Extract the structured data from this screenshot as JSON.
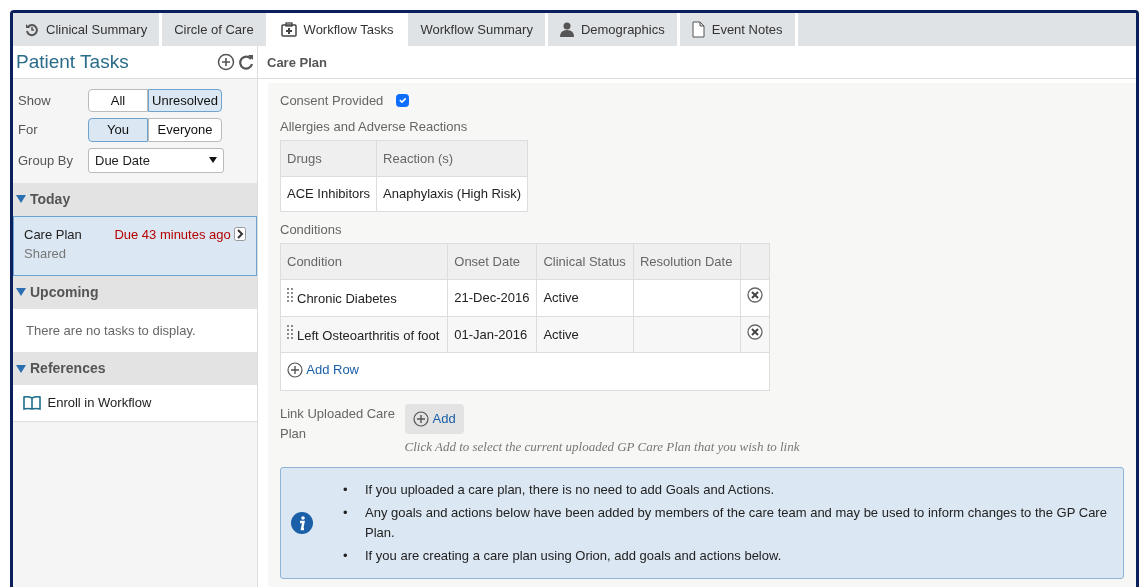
{
  "tabs": [
    {
      "label": "Clinical Summary",
      "selected": false
    },
    {
      "label": "Circle of Care",
      "selected": false
    },
    {
      "label": "Workflow Tasks",
      "selected": true
    },
    {
      "label": "Workflow Summary",
      "selected": false
    },
    {
      "label": "Demographics",
      "selected": false
    },
    {
      "label": "Event Notes",
      "selected": false
    }
  ],
  "sidebar": {
    "title": "Patient Tasks",
    "filters": [
      {
        "label": "Show",
        "kind": "toggle",
        "options": [
          {
            "label": "All",
            "selected": false
          },
          {
            "label": "Unresolved",
            "selected": true
          }
        ]
      },
      {
        "label": "For",
        "kind": "toggle",
        "options": [
          {
            "label": "You",
            "selected": true
          },
          {
            "label": "Everyone",
            "selected": false
          }
        ]
      },
      {
        "label": "Group By",
        "kind": "select",
        "value": "Due Date"
      }
    ],
    "sections": [
      {
        "title": "Today",
        "expanded": true,
        "tasks": [
          {
            "title": "Care Plan",
            "due": "Due 43 minutes ago",
            "subtitle": "Shared",
            "selected": true
          }
        ]
      },
      {
        "title": "Upcoming",
        "expanded": true,
        "empty": "There are no tasks to display."
      },
      {
        "title": "References",
        "expanded": true,
        "links": [
          "Enroll in Workflow"
        ]
      }
    ]
  },
  "main": {
    "title": "Care Plan",
    "consent": {
      "label": "Consent Provided",
      "checked": true
    },
    "allergies": {
      "label": "Allergies and Adverse Reactions",
      "columns": [
        "Drugs",
        "Reaction (s)"
      ],
      "rows": [
        [
          "ACE Inhibitors",
          "Anaphylaxis (High Risk)"
        ]
      ]
    },
    "conditions": {
      "label": "Conditions",
      "columns": [
        "Condition",
        "Onset Date",
        "Clinical Status",
        "Resolution Date"
      ],
      "rows": [
        [
          "Chronic Diabetes",
          "21-Dec-2016",
          "Active",
          ""
        ],
        [
          "Left Osteoarthritis of foot",
          "01-Jan-2016",
          "Active",
          ""
        ]
      ],
      "add_label": "Add Row"
    },
    "link_upload": {
      "label": "Link Uploaded Care Plan",
      "button": "Add",
      "hint": "Click Add to select the current uploaded GP Care Plan that you wish to link"
    },
    "info": [
      {
        "bullet": "•",
        "text": "If you uploaded a care plan, there is no need to add Goals and Actions."
      },
      {
        "bullet": "•",
        "text": "Any goals and actions below have been added by members of the care team and may be used to inform changes to the GP Care Plan."
      },
      {
        "bullet": "•",
        "text": "If you are creating a care plan using Orion, add goals and actions below."
      }
    ]
  }
}
